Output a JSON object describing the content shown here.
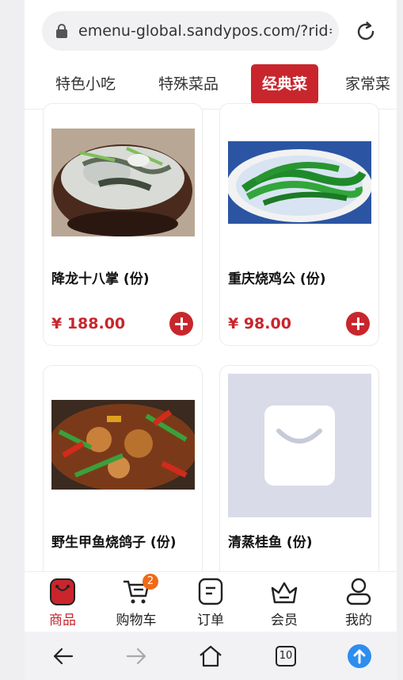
{
  "browser": {
    "url": "emenu-global.sandypos.com/?rid=",
    "tab_count": "10"
  },
  "category_tabs": [
    {
      "label": "特色小吃",
      "active": false
    },
    {
      "label": "特殊菜品",
      "active": false
    },
    {
      "label": "经典菜",
      "active": true
    },
    {
      "label": "家常菜",
      "active": false
    }
  ],
  "dishes": [
    {
      "name": "降龙十八掌 (份)",
      "price": "¥ 188.00",
      "image": "fish-claypot-photo"
    },
    {
      "name": "重庆烧鸡公 (份)",
      "price": "¥ 98.00",
      "image": "green-vegetable-plate-photo"
    },
    {
      "name": "野生甲鱼烧鸽子 (份)",
      "price": "",
      "image": "spicy-stir-fry-photo"
    },
    {
      "name": "清蒸桂鱼 (份)",
      "price": "",
      "image": "shopping-bag-placeholder"
    }
  ],
  "bottom_nav": [
    {
      "label": "商品",
      "icon": "goods-icon",
      "active": true
    },
    {
      "label": "购物车",
      "icon": "cart-icon",
      "active": false,
      "badge": "2"
    },
    {
      "label": "订单",
      "icon": "order-icon",
      "active": false
    },
    {
      "label": "会员",
      "icon": "crown-icon",
      "active": false
    },
    {
      "label": "我的",
      "icon": "profile-icon",
      "active": false
    }
  ],
  "colors": {
    "accent": "#c8262c",
    "badge": "#f06a16",
    "placeholder_bg": "#d9dbe8",
    "upload": "#2d8ef0"
  }
}
